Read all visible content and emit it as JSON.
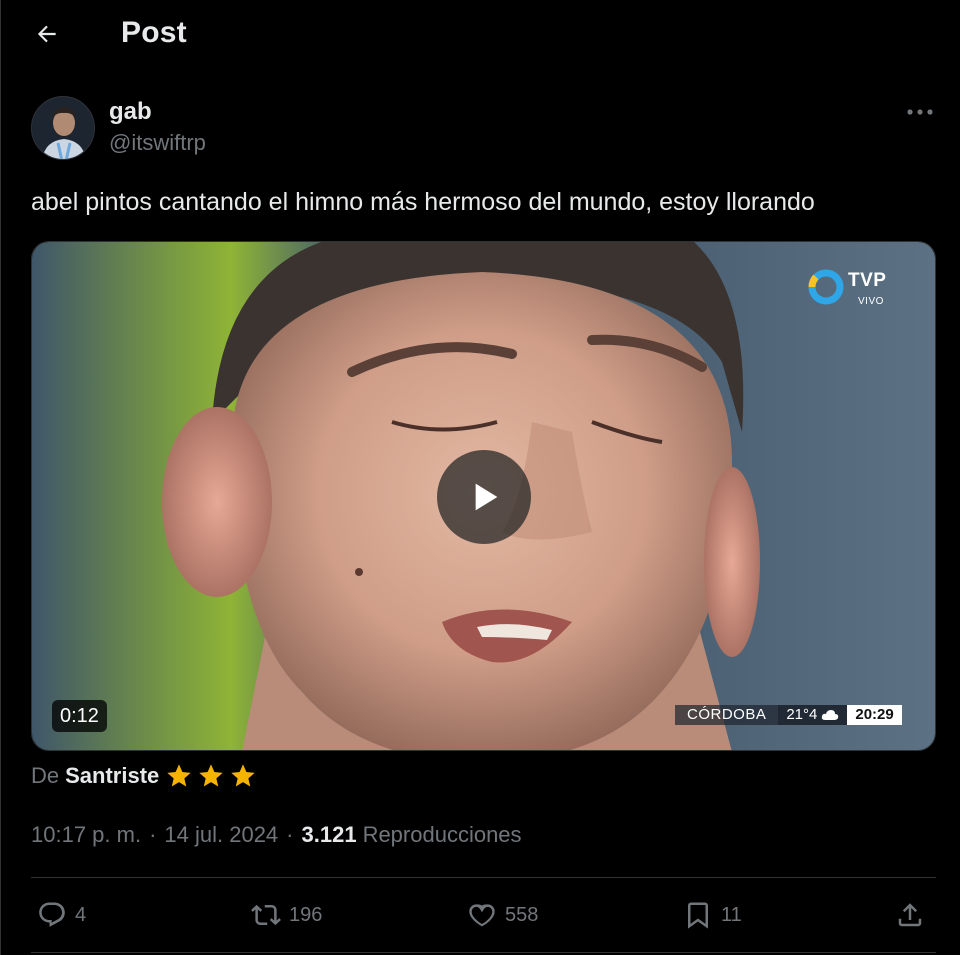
{
  "header": {
    "title": "Post",
    "back_icon": "arrow-left-icon"
  },
  "author": {
    "name": "gab",
    "handle": "@itswiftrp",
    "more_icon": "more-horizontal-icon"
  },
  "post": {
    "text": "abel pintos cantando el himno más hermoso del mundo, estoy llorando"
  },
  "video": {
    "duration": "0:12",
    "play_icon": "play-icon",
    "overlay": {
      "channel": "TVP",
      "channel_sub": "VIVO",
      "city": "CÓRDOBA",
      "temperature": "21°4",
      "weather_icon": "cloud-icon",
      "time": "20:29"
    }
  },
  "attribution": {
    "prefix": "De",
    "name": "Santriste",
    "stars": 3,
    "star_color": "#f4b400"
  },
  "meta": {
    "time": "10:17 p. m.",
    "date": "14 jul. 2024",
    "separator": "·",
    "views_count": "3.121",
    "views_label": "Reproducciones"
  },
  "actions": {
    "reply": {
      "count": "4",
      "icon": "reply-icon"
    },
    "repost": {
      "count": "196",
      "icon": "repost-icon"
    },
    "like": {
      "count": "558",
      "icon": "heart-icon"
    },
    "bookmark": {
      "count": "11",
      "icon": "bookmark-icon"
    },
    "share": {
      "icon": "share-icon"
    }
  },
  "colors": {
    "background": "#000000",
    "text_primary": "#e7e9ea",
    "text_secondary": "#71767b",
    "border": "#2f3336"
  }
}
